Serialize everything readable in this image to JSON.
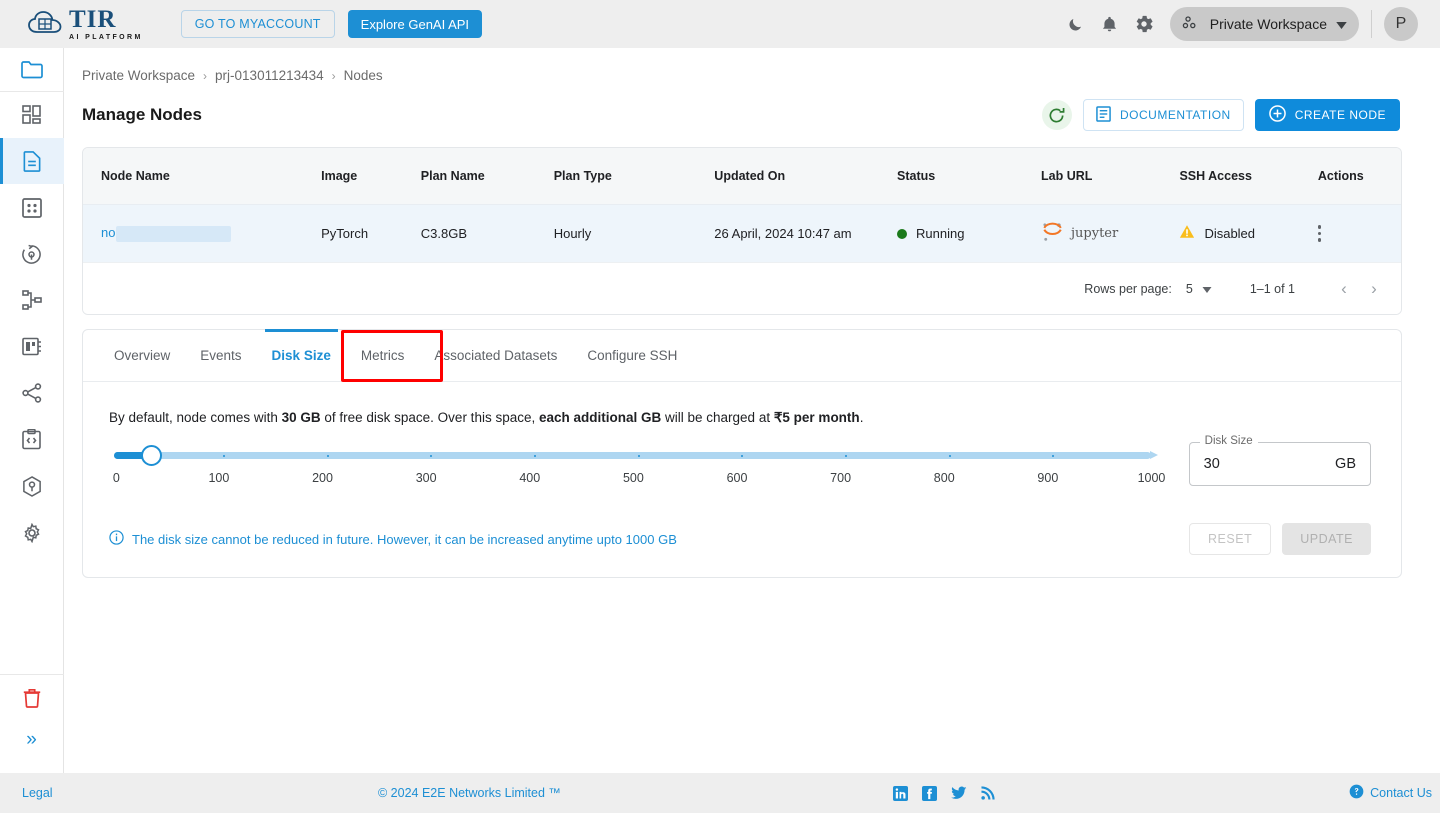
{
  "header": {
    "brand_main": "TIR",
    "brand_sub": "AI PLATFORM",
    "myaccount_label": "GO TO MYACCOUNT",
    "genai_label": "Explore GenAI API",
    "dark_mode_icon": "moon-icon",
    "notifications_icon": "bell-icon",
    "settings_icon": "gear-icon",
    "workspace_label": "Private Workspace",
    "workspace_icon": "workspace-icon",
    "avatar_initial": "P",
    "accent": "#1d8fd4"
  },
  "sidebar": {
    "items": [
      {
        "icon": "folder-icon",
        "name": "projects"
      },
      {
        "icon": "dashboard-grid-icon",
        "name": "dashboard"
      },
      {
        "icon": "document-icon",
        "name": "nodes",
        "active": true
      },
      {
        "icon": "grid-box-icon",
        "name": "datasets"
      },
      {
        "icon": "pipeline-icon",
        "name": "pipelines"
      },
      {
        "icon": "hierarchy-icon",
        "name": "models"
      },
      {
        "icon": "server-icon",
        "name": "inference"
      },
      {
        "icon": "share-nodes-icon",
        "name": "endpoints"
      },
      {
        "icon": "code-clipboard-icon",
        "name": "api"
      },
      {
        "icon": "package-icon",
        "name": "containers"
      },
      {
        "icon": "gear-icon",
        "name": "settings"
      }
    ],
    "trash_icon": "trash-icon",
    "expand_icon": "chevron-double-right-icon"
  },
  "breadcrumb": {
    "items": [
      "Private Workspace",
      "prj-013011213434",
      "Nodes"
    ],
    "separator": "›"
  },
  "page": {
    "title": "Manage Nodes",
    "refresh_icon": "refresh-icon",
    "documentation_label": "DOCUMENTATION",
    "documentation_icon": "document-icon",
    "create_node_label": "CREATE NODE",
    "create_node_icon": "plus-circle-icon"
  },
  "table": {
    "columns": [
      "Node Name",
      "Image",
      "Plan Name",
      "Plan Type",
      "Updated On",
      "Status",
      "Lab URL",
      "SSH Access",
      "Actions"
    ],
    "rows": [
      {
        "node_name": "no",
        "node_name_redacted": true,
        "image": "PyTorch",
        "plan_name": "C3.8GB",
        "plan_type": "Hourly",
        "updated_on": "26 April, 2024 10:47 am",
        "status": "Running",
        "status_color": "#1b7a1b",
        "lab_url": "jupyter",
        "ssh_access": "Disabled",
        "ssh_icon": "warning-triangle-icon",
        "actions_icon": "kebab-menu-icon"
      }
    ]
  },
  "pagination": {
    "rows_per_page_label": "Rows per page:",
    "rows_per_page_value": "5",
    "range_text": "1–1 of 1",
    "prev_icon": "chevron-left-icon",
    "next_icon": "chevron-right-icon"
  },
  "tabs": {
    "items": [
      "Overview",
      "Events",
      "Disk Size",
      "Metrics",
      "Associated Datasets",
      "Configure SSH"
    ],
    "active_index": 2,
    "highlight_color": "#ff0000"
  },
  "disk_panel": {
    "description_parts": [
      {
        "text": "By default, node comes with ",
        "bold": false
      },
      {
        "text": "30 GB",
        "bold": true
      },
      {
        "text": " of free disk space. Over this space, ",
        "bold": false
      },
      {
        "text": "each additional GB",
        "bold": true
      },
      {
        "text": " will be charged at ",
        "bold": false
      },
      {
        "text": "₹5 per month",
        "bold": true
      },
      {
        "text": ".",
        "bold": false
      }
    ],
    "slider": {
      "min": 0,
      "max": 1000,
      "value": 30,
      "tick_labels": [
        "0",
        "100",
        "200",
        "300",
        "400",
        "500",
        "600",
        "700",
        "800",
        "900",
        "1000"
      ],
      "track_color": "#aed6f1",
      "fill_color": "#1d8fd4"
    },
    "disk_size_field": {
      "legend": "Disk Size",
      "value": "30",
      "unit": "GB"
    },
    "note": "The disk size cannot be reduced in future. However, it can be increased anytime upto 1000 GB",
    "note_icon": "info-circle-icon",
    "reset_label": "RESET",
    "update_label": "UPDATE",
    "buttons_disabled": true
  },
  "footer": {
    "legal": "Legal",
    "copyright": "© 2024 E2E Networks Limited ™",
    "social": [
      "linkedin-icon",
      "facebook-icon",
      "twitter-icon",
      "rss-icon"
    ],
    "contact_label": "Contact Us",
    "contact_icon": "help-circle-icon"
  }
}
